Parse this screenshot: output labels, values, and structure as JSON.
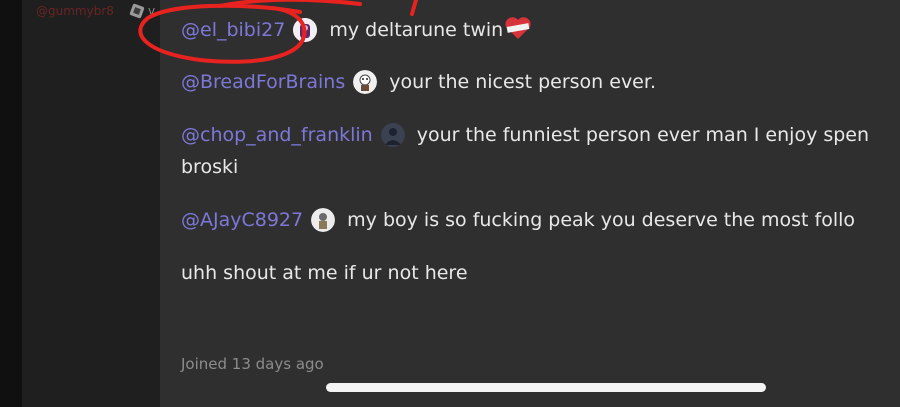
{
  "sidebar": {
    "username": "@gummybr8",
    "extra": "v"
  },
  "messages": [
    {
      "mention": "@el_bibi27",
      "avatar_icon": "purple-character-avatar",
      "text": " my deltarune twin",
      "trailing_emoji": "bandaged-heart-icon"
    },
    {
      "mention": "@BreadForBrains",
      "avatar_icon": "white-character-avatar",
      "text": " your the nicest person ever."
    },
    {
      "mention": "@chop_and_franklin",
      "avatar_icon": "dark-figure-avatar",
      "text": " your the funniest person ever man I enjoy spen",
      "continuation": "broski"
    },
    {
      "mention": "@AJayC8927",
      "avatar_icon": "gray-character-avatar",
      "text": " my boy is so fucking peak you deserve the most follo"
    },
    {
      "text": "uhh shout at me if ur not here"
    }
  ],
  "joined_text": "Joined 13 days ago",
  "colors": {
    "mention": "#7d78d8",
    "panel_bg": "#2f2f2f",
    "annotation": "#e8231f"
  }
}
